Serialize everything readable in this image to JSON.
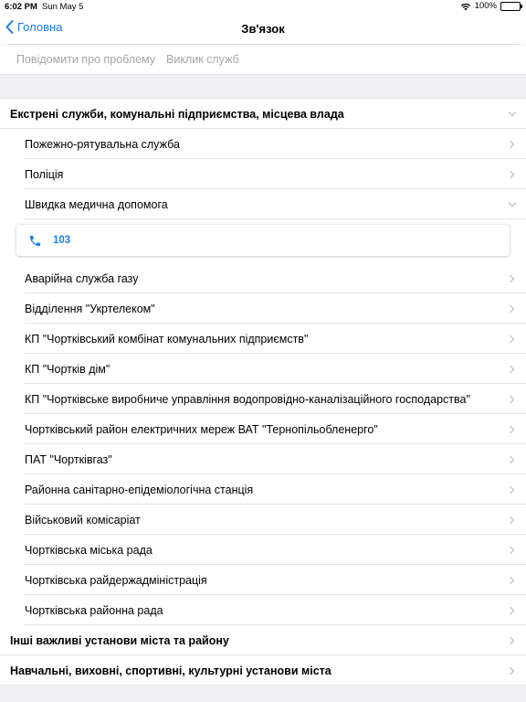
{
  "status": {
    "time": "6:02 PM",
    "date": "Sun May 5",
    "battery": "100%"
  },
  "nav": {
    "back_label": "Головна",
    "title": "Зв'язок"
  },
  "toolbar": {
    "report_label": "Повідомити про проблему",
    "call_label": "Виклик служб"
  },
  "list": {
    "section1": "Екстрені служби, комунальні підприємства, місцева влада",
    "items_top": [
      "Пожежно-рятувальна служба",
      "Поліція",
      "Швидка медична допомога"
    ],
    "ambulance_phone": "103",
    "items_bottom": [
      "Аварійна служба газу",
      "Відділення \"Укртелеком\"",
      "КП \"Чортківський комбінат комунальних підприємств\"",
      "КП \"Чортків дім\"",
      "КП \"Чортківське виробниче управління водопровідно-каналізаційного господарства\"",
      "Чортківський район електричних мереж ВАТ \"Тернопільобленерго\"",
      "ПАТ \"Чортківгаз\"",
      "Районна санітарно-епідеміологічна станція",
      "Військовий комісаріат",
      "Чортківська міська рада",
      "Чортківська райдержадміністрація",
      "Чортківська районна рада"
    ],
    "section2": "Інші важливі установи міста та району",
    "section3": "Навчальні, виховні, спортивні, культурні установи міста"
  },
  "colors": {
    "accent": "#1a7cf0",
    "toolbar_text": "#a5a5aa",
    "background": "#efeff4"
  },
  "icons": {
    "back": "chevron-left-icon",
    "row_right": "chevron-right-icon",
    "expanded": "chevron-down-icon",
    "phone": "phone-icon"
  }
}
